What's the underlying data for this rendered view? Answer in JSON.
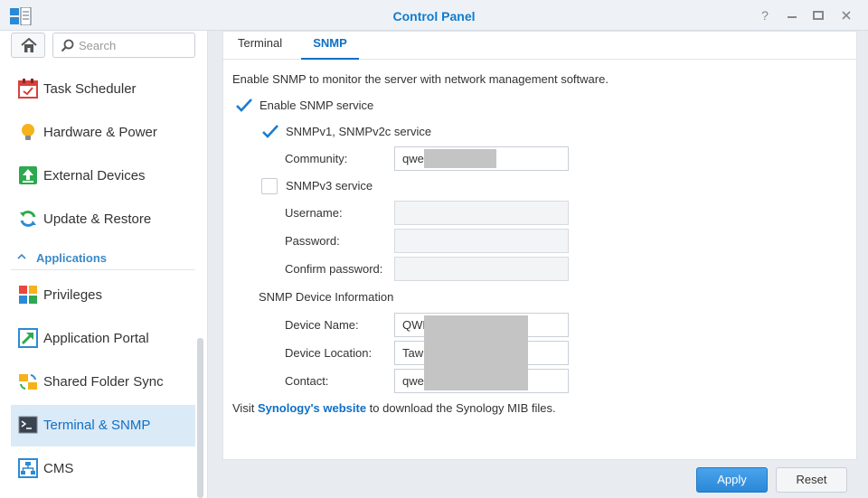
{
  "window": {
    "title": "Control Panel",
    "help_icon": "help-icon",
    "minimize_icon": "minimize-icon",
    "maximize_icon": "maximize-icon",
    "close_icon": "close-icon"
  },
  "sidebar": {
    "search_placeholder": "Search",
    "items": [
      {
        "label": "Task Scheduler",
        "icon": "calendar-icon"
      },
      {
        "label": "Hardware & Power",
        "icon": "lightbulb-icon"
      },
      {
        "label": "External Devices",
        "icon": "upload-icon"
      },
      {
        "label": "Update & Restore",
        "icon": "refresh-icon"
      }
    ],
    "section": {
      "label": "Applications",
      "icon": "chevron-up-icon"
    },
    "app_items": [
      {
        "label": "Privileges",
        "icon": "grid-icon"
      },
      {
        "label": "Application Portal",
        "icon": "arrow-out-icon"
      },
      {
        "label": "Shared Folder Sync",
        "icon": "sync-icon"
      },
      {
        "label": "Terminal & SNMP",
        "icon": "terminal-icon",
        "active": true
      },
      {
        "label": "CMS",
        "icon": "network-icon"
      }
    ]
  },
  "tabs": [
    {
      "label": "Terminal"
    },
    {
      "label": "SNMP",
      "active": true
    }
  ],
  "snmp": {
    "description": "Enable SNMP to monitor the server with network management software.",
    "enable_label": "Enable SNMP service",
    "enable_checked": true,
    "v1_label": "SNMPv1, SNMPv2c service",
    "v1_checked": true,
    "community_label": "Community:",
    "community_value": "qwe",
    "v3_label": "SNMPv3 service",
    "v3_checked": false,
    "username_label": "Username:",
    "password_label": "Password:",
    "confirm_label": "Confirm password:",
    "device_info_label": "SNMP Device Information",
    "device_name_label": "Device Name:",
    "device_name_value": "QWE",
    "device_location_label": "Device Location:",
    "device_location_value": "Taw",
    "contact_label": "Contact:",
    "contact_value": "qwe",
    "footer_prefix": "Visit ",
    "footer_link": "Synology's website",
    "footer_suffix": " to download the Synology MIB files."
  },
  "buttons": {
    "apply": "Apply",
    "reset": "Reset"
  },
  "colors": {
    "accent": "#0f6fc6",
    "apply_button": "#2a88d8",
    "active_item_bg": "#dbeaf7"
  }
}
